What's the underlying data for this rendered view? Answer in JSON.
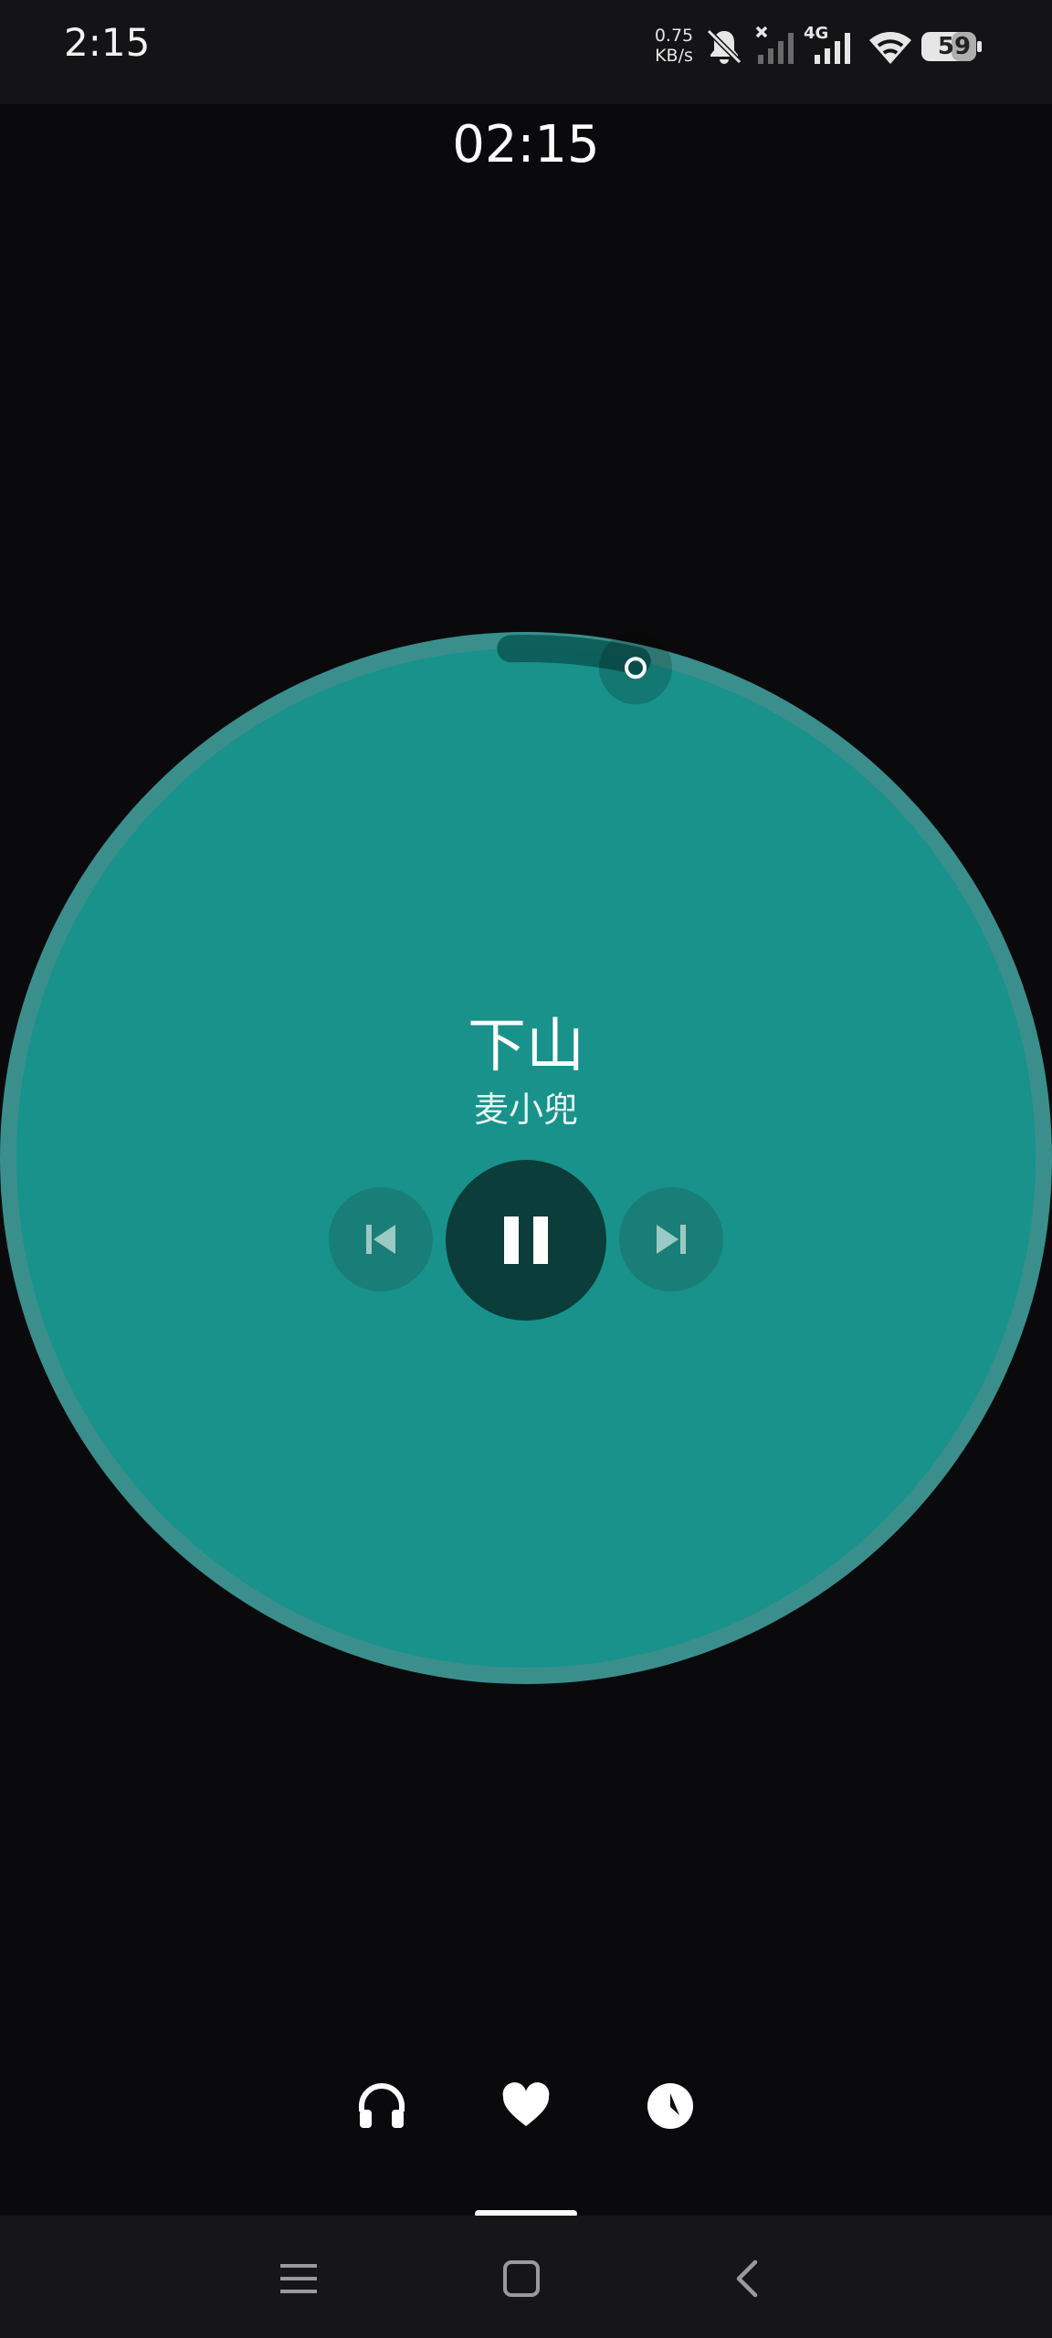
{
  "status_bar": {
    "time": "2:15",
    "net_speed_value": "0.75",
    "net_speed_unit": "KB/s",
    "network_type": "4G",
    "battery_level": "59",
    "icons": [
      "bell-muted-icon",
      "signal-sim1-no-service-icon",
      "signal-sim2-icon",
      "wifi-icon",
      "battery-icon"
    ]
  },
  "clock": {
    "time": "02:15"
  },
  "player": {
    "title": "下山",
    "artist": "麦小兜",
    "progress_fraction": 0.035,
    "is_playing": true,
    "controls": {
      "prev_icon": "skip-previous-icon",
      "play_pause_icon": "pause-icon",
      "next_icon": "skip-next-icon"
    }
  },
  "tabs": [
    {
      "id": "headphones",
      "icon": "headphones-icon"
    },
    {
      "id": "favorites",
      "icon": "heart-icon"
    },
    {
      "id": "history",
      "icon": "clock-icon"
    }
  ],
  "nav_bar": {
    "icons": [
      "menu-icon",
      "home-square-icon",
      "back-chevron-icon"
    ]
  },
  "colors": {
    "background": "#0a0a0c",
    "disc": "#18928b",
    "disc_ring": "#3a8f8c",
    "play_button": "#0b3d3a",
    "side_buttons": "#197e77"
  }
}
